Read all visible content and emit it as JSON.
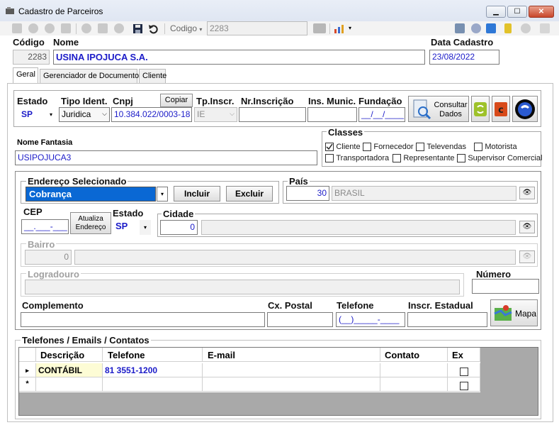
{
  "window": {
    "title": "Cadastro de Parceiros",
    "min": "▁",
    "max": "☐",
    "close": "✕"
  },
  "toolbar": {
    "search_field": "Codigo",
    "search_value": "2283"
  },
  "header": {
    "codigo_label": "Código",
    "nome_label": "Nome",
    "data_label": "Data Cadastro",
    "codigo": "2283",
    "nome": "USINA IPOJUCA S.A.",
    "data": "23/08/2022"
  },
  "tabs": [
    {
      "label": "Geral"
    },
    {
      "label": "Gerenciador de Documentos"
    },
    {
      "label": "Cliente"
    }
  ],
  "geral": {
    "estado_label": "Estado",
    "estado": "SP",
    "tipo_label": "Tipo Ident.",
    "tipo": "Juridica",
    "cnpj_label": "Cnpj",
    "copiar": "Copiar",
    "cnpj": "10.384.022/0003-18",
    "tpinscr_label": "Tp.Inscr.",
    "tpinscr": "IE",
    "nrinscr_label": "Nr.Inscrição",
    "insmunic_label": "Ins. Munic.",
    "fundacao_label": "Fundação",
    "fundacao": "__/__/____",
    "consultar": "Consultar Dados",
    "nome_fantasia_label": "Nome Fantasia",
    "nome_fantasia": "USIPOJUCA3",
    "classes_label": "Classes",
    "classes": [
      {
        "label": "Cliente",
        "checked": true
      },
      {
        "label": "Fornecedor",
        "checked": false
      },
      {
        "label": "Televendas",
        "checked": false
      },
      {
        "label": "Motorista",
        "checked": false
      },
      {
        "label": "Transportadora",
        "checked": false
      },
      {
        "label": "Representante",
        "checked": false
      },
      {
        "label": "Supervisor Comercial",
        "checked": false
      }
    ]
  },
  "endereco": {
    "selecionado_label": "Endereço Selecionado",
    "selecionado": "Cobrança",
    "incluir": "Incluir",
    "excluir": "Excluir",
    "pais_label": "País",
    "pais_code": "30",
    "pais_name": "BRASIL",
    "cep_label": "CEP",
    "cep": "__.___-___",
    "atualiza": "Atualiza Endereço",
    "estado_label": "Estado",
    "estado": "SP",
    "cidade_label": "Cidade",
    "cidade_code": "0",
    "bairro_label": "Bairro",
    "bairro_code": "0",
    "logradouro_label": "Logradouro",
    "numero_label": "Número",
    "complemento_label": "Complemento",
    "cxpostal_label": "Cx. Postal",
    "telefone_label": "Telefone",
    "telefone": "(__)_____-____",
    "inscr_label": "Inscr. Estadual",
    "mapa": "Mapa"
  },
  "contatos": {
    "label": "Telefones / Emails / Contatos",
    "columns": [
      "Descrição",
      "Telefone",
      "E-mail",
      "Contato",
      "Ex"
    ],
    "rows": [
      {
        "marker": "▸",
        "descricao": "CONTÁBIL",
        "telefone": "81 3551-1200",
        "email": "",
        "contato": ""
      },
      {
        "marker": "*",
        "descricao": "",
        "telefone": "",
        "email": "",
        "contato": ""
      }
    ]
  }
}
